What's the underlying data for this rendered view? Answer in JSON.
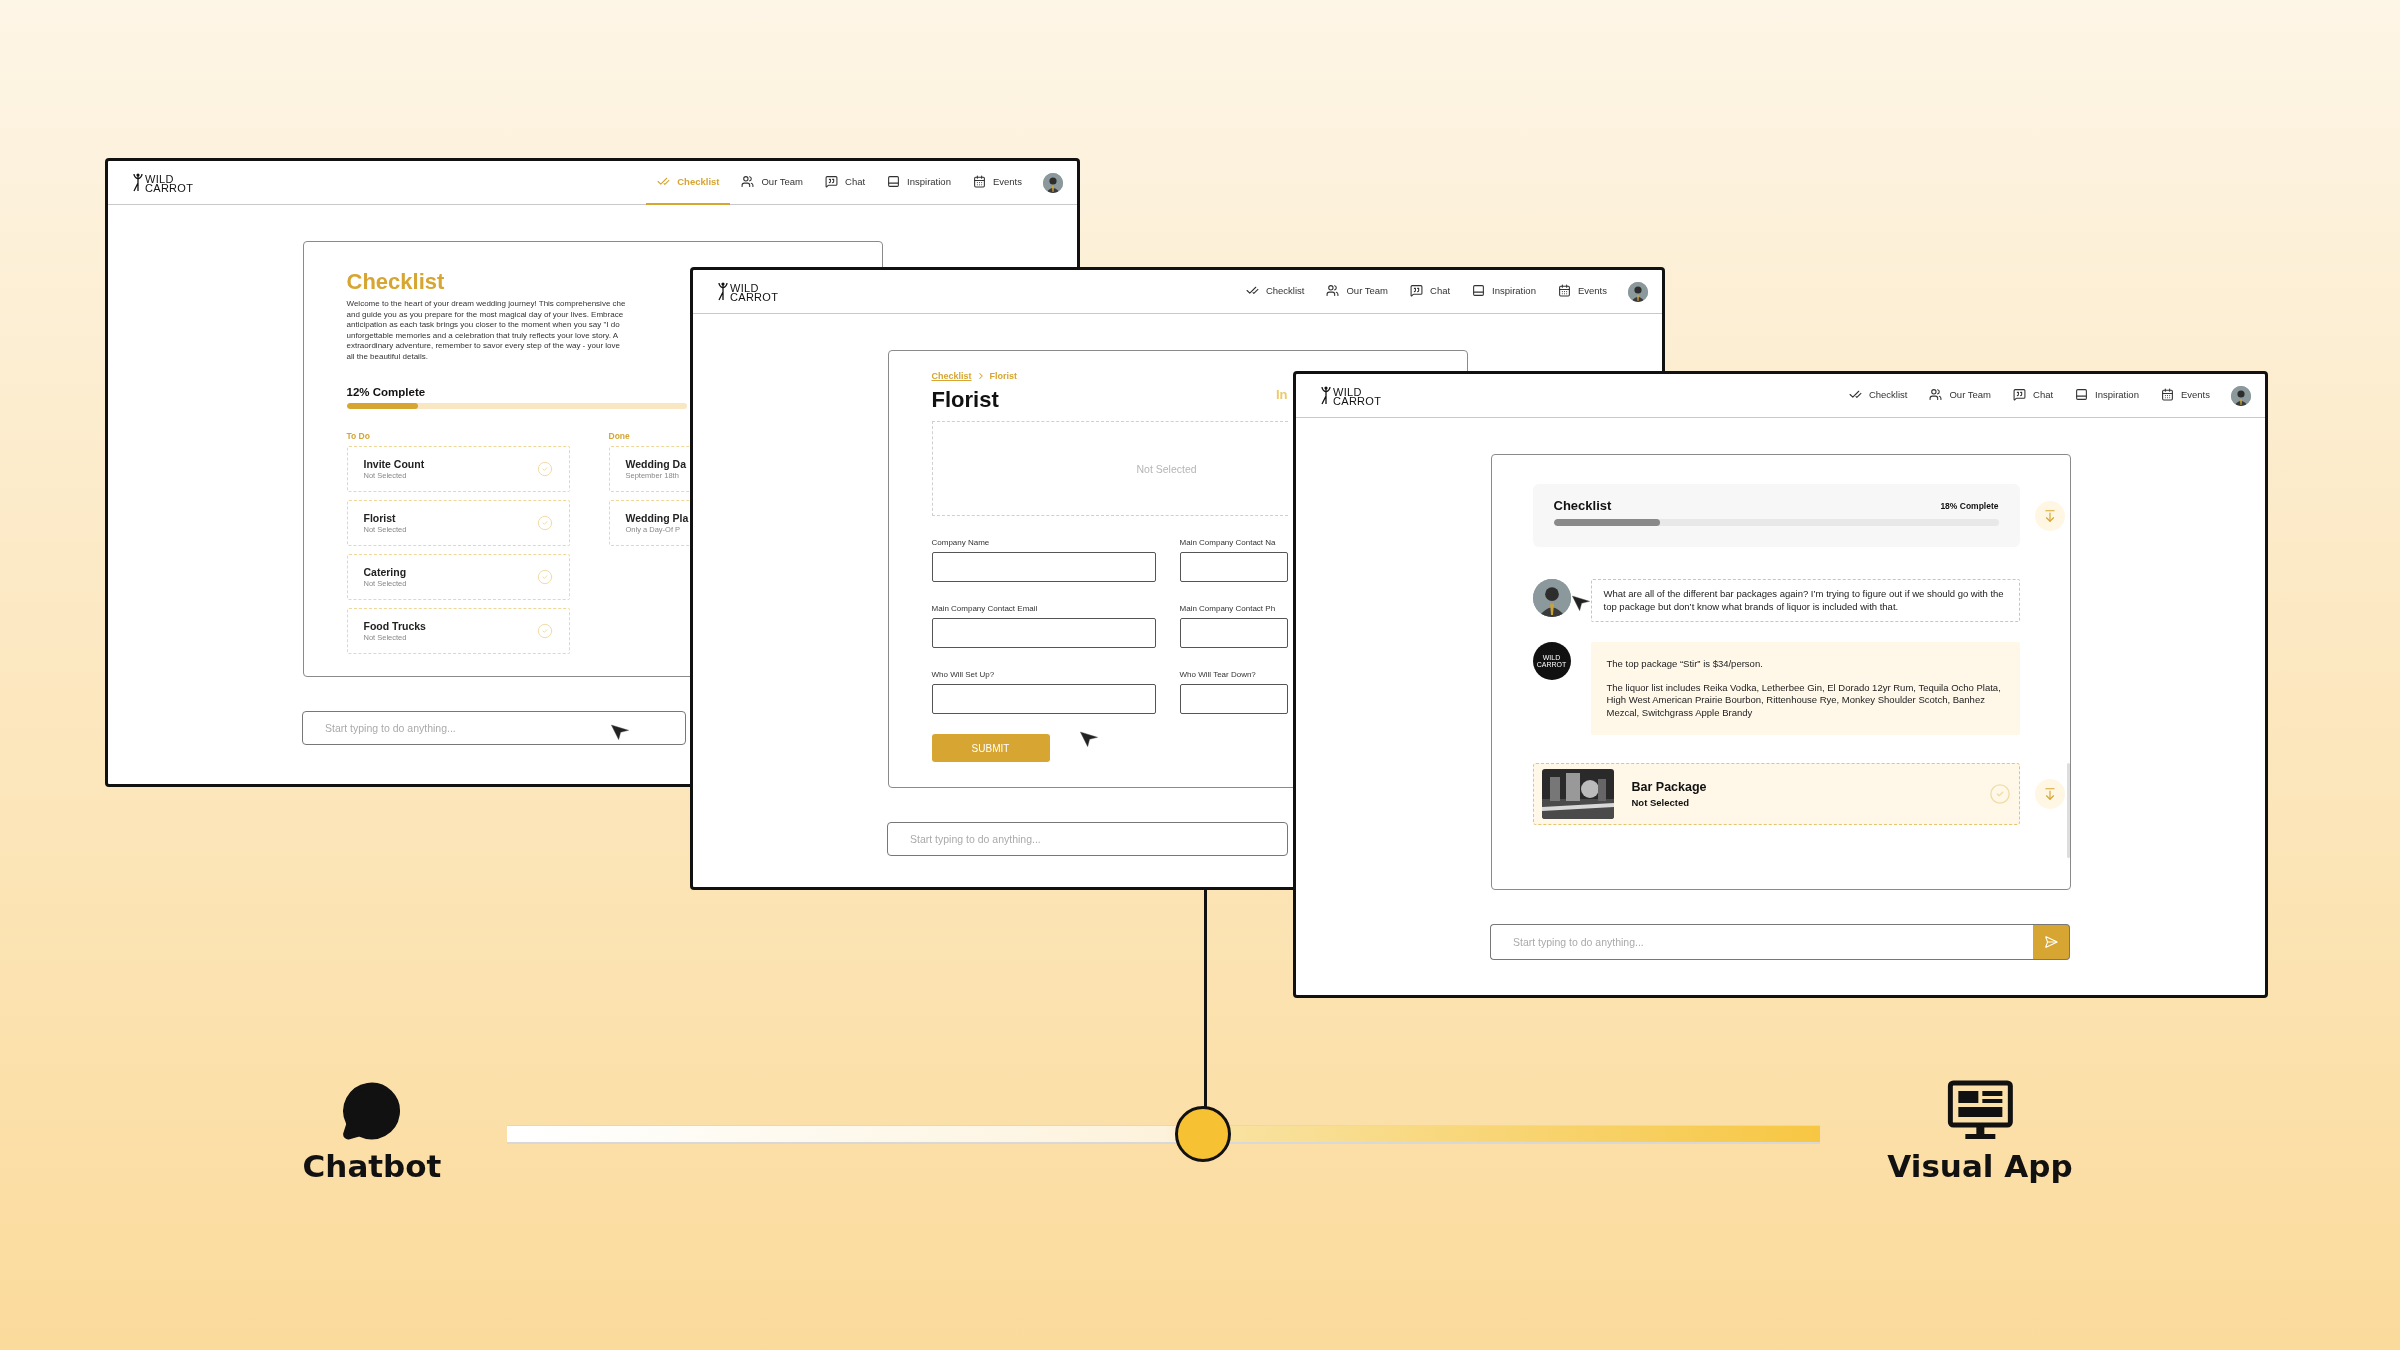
{
  "windows": [
    {
      "kind": "checklist",
      "logo": "WILD CARROT",
      "nav": [
        {
          "kind": "checklist",
          "label": "Checklist",
          "selected": true
        },
        {
          "kind": "team",
          "label": "Our Team",
          "selected": false
        },
        {
          "kind": "chat",
          "label": "Chat",
          "selected": false
        },
        {
          "kind": "inspiration",
          "label": "Inspiration",
          "selected": false
        },
        {
          "kind": "events",
          "label": "Events",
          "selected": false
        }
      ],
      "card": {
        "title": "Checklist",
        "description_lines": [
          "Welcome to the heart of your dream wedding journey! This comprehensive che",
          "and guide you as you prepare for the most magical day of your lives. Embrace",
          "anticipation as each task brings you closer to the moment when you say \"I do",
          "unforgettable memories and a celebration that truly reflects your love story. A",
          "extraordinary adventure, remember to savor every step of the way - your love",
          "all the beautiful details."
        ],
        "progress": {
          "label": "12% Complete",
          "level": 0.21
        },
        "columns": [
          {
            "title": "To Do",
            "items": [
              {
                "name": "Invite Count",
                "status": "Not Selected"
              },
              {
                "name": "Florist",
                "status": "Not Selected"
              },
              {
                "name": "Catering",
                "status": "Not Selected"
              },
              {
                "name": "Food Trucks",
                "status": "Not Selected"
              }
            ]
          },
          {
            "title": "Done",
            "items": [
              {
                "name": "Wedding Da",
                "status": "September 18th"
              },
              {
                "name": "Wedding Pla",
                "status": "Only a Day-Of P"
              }
            ]
          }
        ]
      },
      "input": {
        "placeholder": "Start typing to do anything..."
      }
    },
    {
      "kind": "form",
      "logo": "WILD CARROT",
      "nav": [
        {
          "kind": "checklist",
          "label": "Checklist",
          "selected": false
        },
        {
          "kind": "team",
          "label": "Our Team",
          "selected": false
        },
        {
          "kind": "chat",
          "label": "Chat",
          "selected": false
        },
        {
          "kind": "inspiration",
          "label": "Inspiration",
          "selected": false
        },
        {
          "kind": "events",
          "label": "Events",
          "selected": false
        }
      ],
      "card": {
        "breadcrumb": [
          "Checklist",
          "Florist"
        ],
        "title": "Florist",
        "status": "In",
        "dropzone": "Not Selected",
        "fields": [
          {
            "label": "Company Name"
          },
          {
            "label": "Main Company Contact Na"
          },
          {
            "label": "Main Company Contact Email"
          },
          {
            "label": "Main Company Contact Ph"
          },
          {
            "label": "Who Will Set Up?"
          },
          {
            "label": "Who Will Tear Down?"
          }
        ],
        "submit": "SUBMIT"
      },
      "input": {
        "placeholder": "Start typing to do anything..."
      }
    },
    {
      "kind": "chat",
      "logo": "WILD CARROT",
      "nav": [
        {
          "kind": "checklist",
          "label": "Checklist",
          "selected": false
        },
        {
          "kind": "team",
          "label": "Our Team",
          "selected": false
        },
        {
          "kind": "chat",
          "label": "Chat",
          "selected": false
        },
        {
          "kind": "inspiration",
          "label": "Inspiration",
          "selected": false
        },
        {
          "kind": "events",
          "label": "Events",
          "selected": false
        }
      ],
      "card": {
        "header": {
          "title": "Checklist",
          "progress_label": "18% Complete",
          "level": 0.24
        },
        "messages": [
          {
            "kind": "user",
            "paragraphs": [
              "What are all of the different bar packages again? I’m trying to figure out if we should go with the top package but don’t know what brands of liquor is included with that."
            ]
          },
          {
            "kind": "bot",
            "avatar": "WILD CARROT",
            "paragraphs": [
              "The top package “Stir” is $34/person.",
              "The liquor list includes Reika Vodka, Letherbee Gin, El Dorado 12yr Rum, Tequila Ocho Plata, High West American Prairie Bourbon, Rittenhouse Rye, Monkey Shoulder Scotch, Banhez Mezcal, Switchgrass Apple Brandy"
            ]
          }
        ],
        "item": {
          "title": "Bar Package",
          "status": "Not Selected"
        }
      },
      "input": {
        "placeholder": "Start typing to do anything..."
      }
    }
  ],
  "slider": {
    "left_label": "Chatbot",
    "right_label": "Visual App",
    "level": 0.53
  }
}
